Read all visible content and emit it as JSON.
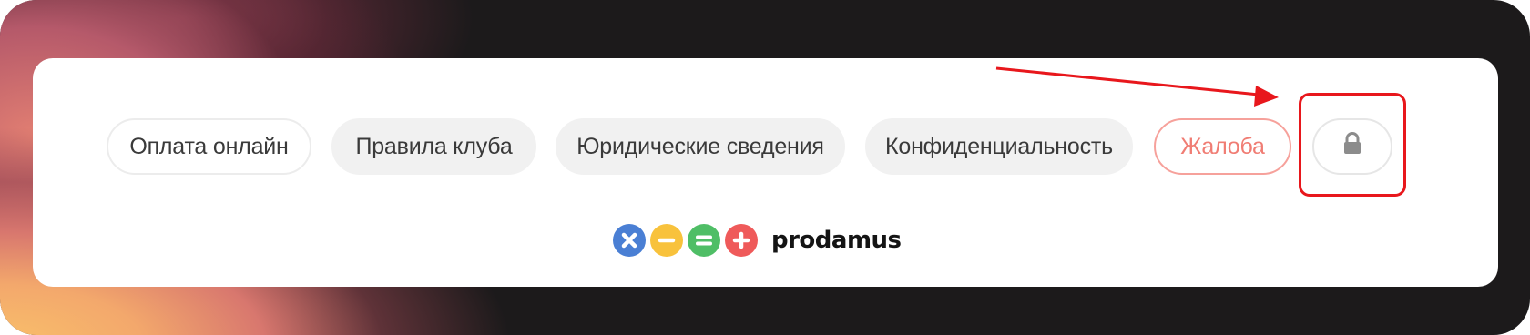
{
  "footer_nav": {
    "items": [
      {
        "label": "Оплата онлайн"
      },
      {
        "label": "Правила клуба"
      },
      {
        "label": "Юридические сведения"
      },
      {
        "label": "Конфиденциальность"
      }
    ],
    "complaint_label": "Жалоба",
    "lock_icon": "lock-icon"
  },
  "brand": {
    "name": "prodamus",
    "icons": [
      "multiply-icon",
      "minus-icon",
      "equals-icon",
      "plus-icon"
    ],
    "icon_colors": [
      "#4a7fd4",
      "#f8c23c",
      "#4fbe66",
      "#ef5a5a"
    ]
  },
  "annotation": {
    "color": "#e8171c"
  },
  "theme": {
    "complaint_color": "#f07d74",
    "background": "#1c1a1b",
    "card": "#ffffff"
  }
}
